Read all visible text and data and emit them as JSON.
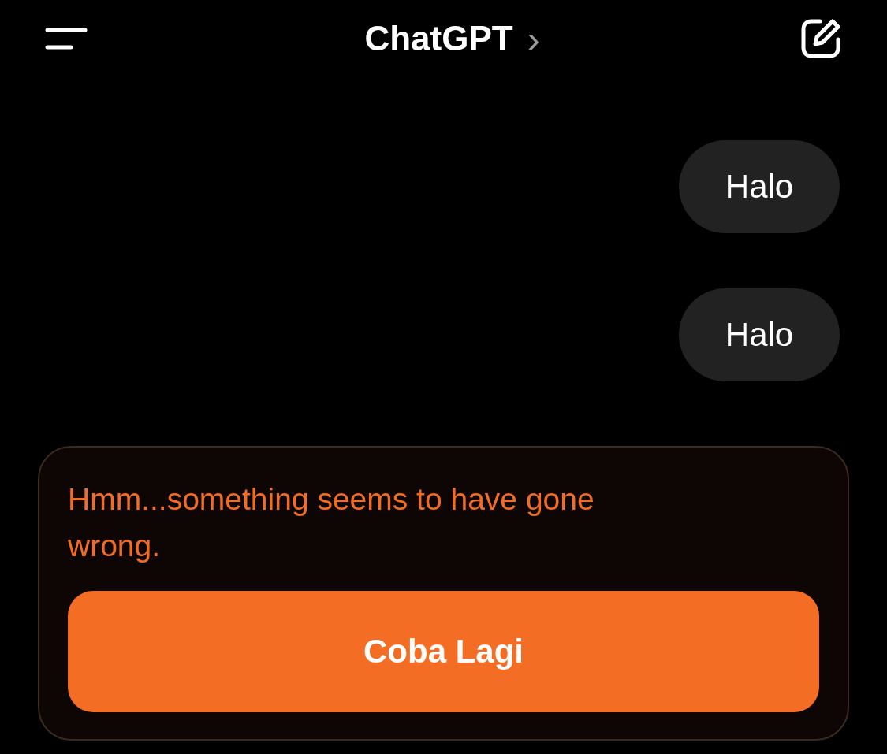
{
  "header": {
    "title": "ChatGPT",
    "chevron": "›"
  },
  "messages": [
    {
      "kind": "user",
      "text": "Halo"
    },
    {
      "kind": "user",
      "text": "Halo"
    }
  ],
  "error": {
    "message": "Hmm...something seems to have gone wrong.",
    "button": "Coba Lagi"
  }
}
